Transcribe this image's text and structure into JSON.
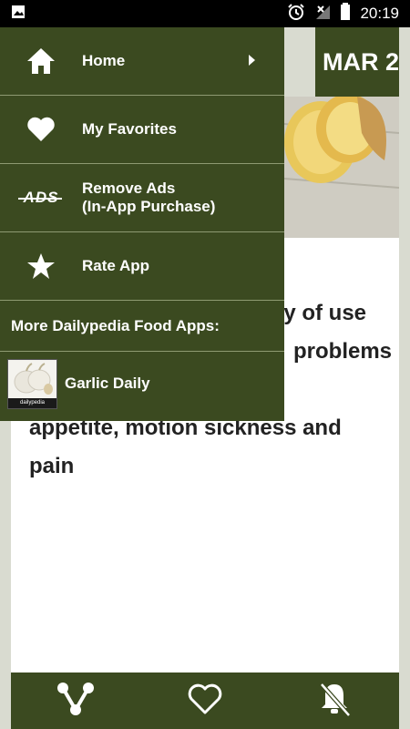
{
  "status_bar": {
    "time": "20:19",
    "icons": [
      "image-icon",
      "alarm-icon",
      "no-signal-icon",
      "battery-icon"
    ]
  },
  "header": {
    "date_label": "MAR 2"
  },
  "article": {
    "text": "ry of use problems appetite, motion sickness and pain",
    "lines": [
      "ry of use",
      "problems",
      "",
      "appetite, motion sickness and",
      "pain"
    ]
  },
  "drawer": {
    "items": [
      {
        "label": "Home",
        "icon": "home-icon"
      },
      {
        "label": "My Favorites",
        "icon": "heart-icon"
      },
      {
        "label": "Remove Ads\n(In-App Purchase)",
        "label_line1": "Remove Ads",
        "label_line2": "(In-App Purchase)",
        "icon": "no-ads-icon",
        "icon_text": "ADS"
      },
      {
        "label": "Rate App",
        "icon": "star-icon"
      }
    ],
    "section_header": "More Dailypedia Food Apps:",
    "apps": [
      {
        "name": "Garlic Daily",
        "thumb_caption": "dailypedia"
      }
    ]
  },
  "bottom_bar": {
    "buttons": [
      "share-icon",
      "favorite-icon",
      "notifications-off-icon"
    ]
  },
  "colors": {
    "primary": "#3b4a20",
    "background": "#d9dbd0",
    "divider": "#8e9a72"
  }
}
